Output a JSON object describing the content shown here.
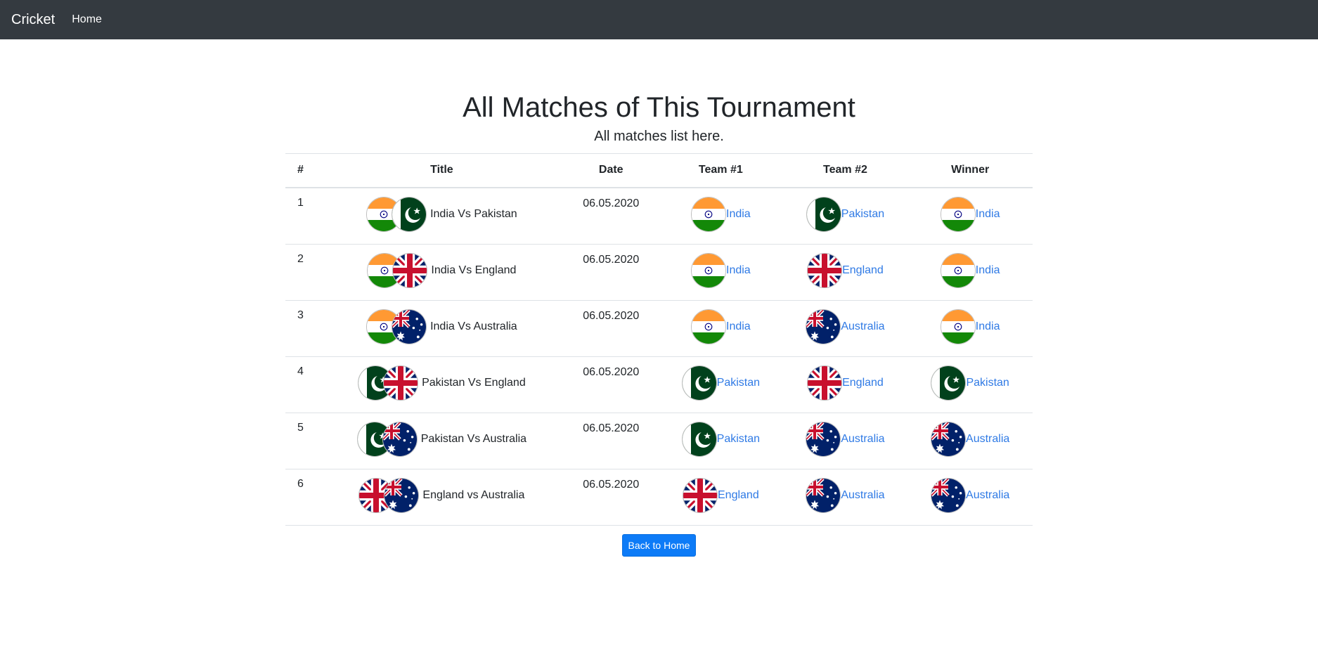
{
  "navbar": {
    "brand": "Cricket",
    "home_link": "Home"
  },
  "header": {
    "title": "All Matches of This Tournament",
    "subtitle": "All matches list here."
  },
  "table": {
    "columns": [
      "#",
      "Title",
      "Date",
      "Team #1",
      "Team #2",
      "Winner"
    ],
    "rows": [
      {
        "num": "1",
        "title": "India Vs Pakistan",
        "flags": [
          "india-flag-icon",
          "pakistan-flag-icon"
        ],
        "date": "06.05.2020",
        "team1": "India",
        "team1_flag": "india-flag-icon",
        "team2": "Pakistan",
        "team2_flag": "pakistan-flag-icon",
        "winner": "India",
        "winner_flag": "india-flag-icon"
      },
      {
        "num": "2",
        "title": "India Vs England",
        "flags": [
          "india-flag-icon",
          "england-flag-icon"
        ],
        "date": "06.05.2020",
        "team1": "India",
        "team1_flag": "india-flag-icon",
        "team2": "England",
        "team2_flag": "england-flag-icon",
        "winner": "India",
        "winner_flag": "india-flag-icon"
      },
      {
        "num": "3",
        "title": "India Vs Australia",
        "flags": [
          "india-flag-icon",
          "australia-flag-icon"
        ],
        "date": "06.05.2020",
        "team1": "India",
        "team1_flag": "india-flag-icon",
        "team2": "Australia",
        "team2_flag": "australia-flag-icon",
        "winner": "India",
        "winner_flag": "india-flag-icon"
      },
      {
        "num": "4",
        "title": "Pakistan Vs England",
        "flags": [
          "pakistan-flag-icon",
          "england-flag-icon"
        ],
        "date": "06.05.2020",
        "team1": "Pakistan",
        "team1_flag": "pakistan-flag-icon",
        "team2": "England",
        "team2_flag": "england-flag-icon",
        "winner": "Pakistan",
        "winner_flag": "pakistan-flag-icon"
      },
      {
        "num": "5",
        "title": "Pakistan Vs Australia",
        "flags": [
          "pakistan-flag-icon",
          "australia-flag-icon"
        ],
        "date": "06.05.2020",
        "team1": "Pakistan",
        "team1_flag": "pakistan-flag-icon",
        "team2": "Australia",
        "team2_flag": "australia-flag-icon",
        "winner": "Australia",
        "winner_flag": "australia-flag-icon"
      },
      {
        "num": "6",
        "title": "England vs Australia",
        "flags": [
          "england-flag-icon",
          "australia-flag-icon"
        ],
        "date": "06.05.2020",
        "team1": "England",
        "team1_flag": "england-flag-icon",
        "team2": "Australia",
        "team2_flag": "australia-flag-icon",
        "winner": "Australia",
        "winner_flag": "australia-flag-icon"
      }
    ]
  },
  "footer": {
    "back_button": "Back to Home"
  },
  "colors": {
    "navbar_bg": "#343a40",
    "link": "#2f7ae5",
    "button": "#0d7bf7"
  }
}
